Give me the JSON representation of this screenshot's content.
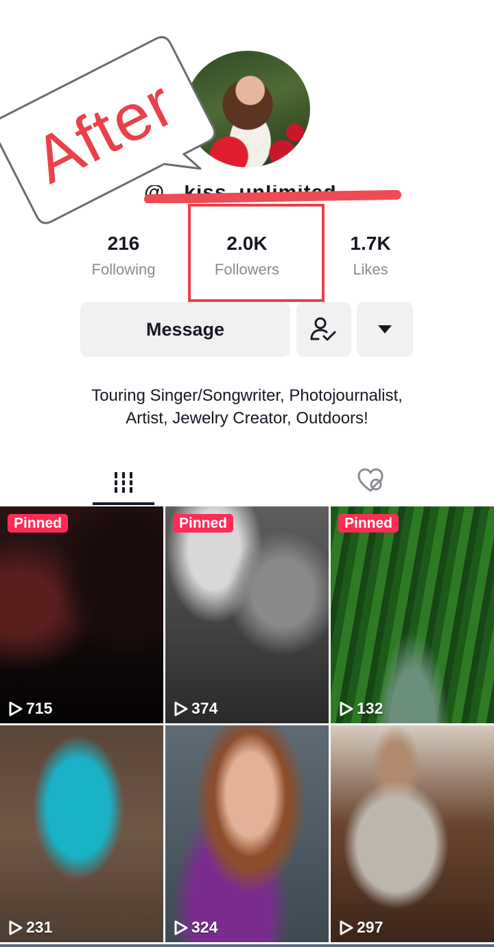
{
  "profile": {
    "username": "@...kiss_unlimited",
    "stats": [
      {
        "value": "216",
        "label": "Following"
      },
      {
        "value": "2.0K",
        "label": "Followers"
      },
      {
        "value": "1.7K",
        "label": "Likes"
      }
    ],
    "bio_line1": "Touring Singer/Songwriter, Photojournalist,",
    "bio_line2": "Artist, Jewelry Creator, Outdoors!"
  },
  "actions": {
    "message_label": "Message",
    "follow_icon": "user-check-icon",
    "more_icon": "caret-down-icon"
  },
  "annotation": {
    "after_text": "After",
    "accent_color": "#e8414a"
  },
  "tabs": {
    "videos_icon": "grid-icon",
    "liked_icon": "liked-hidden-icon"
  },
  "videos": [
    {
      "pinned": "Pinned",
      "views": "715"
    },
    {
      "pinned": "Pinned",
      "views": "374"
    },
    {
      "pinned": "Pinned",
      "views": "132"
    },
    {
      "pinned": "",
      "views": "231"
    },
    {
      "pinned": "",
      "views": "324"
    },
    {
      "pinned": "",
      "views": "297"
    }
  ],
  "colors": {
    "pinned_badge": "#fe2c55",
    "button_bg": "#f1f1f2",
    "text_primary": "#161823",
    "text_secondary": "#8a8b91"
  }
}
